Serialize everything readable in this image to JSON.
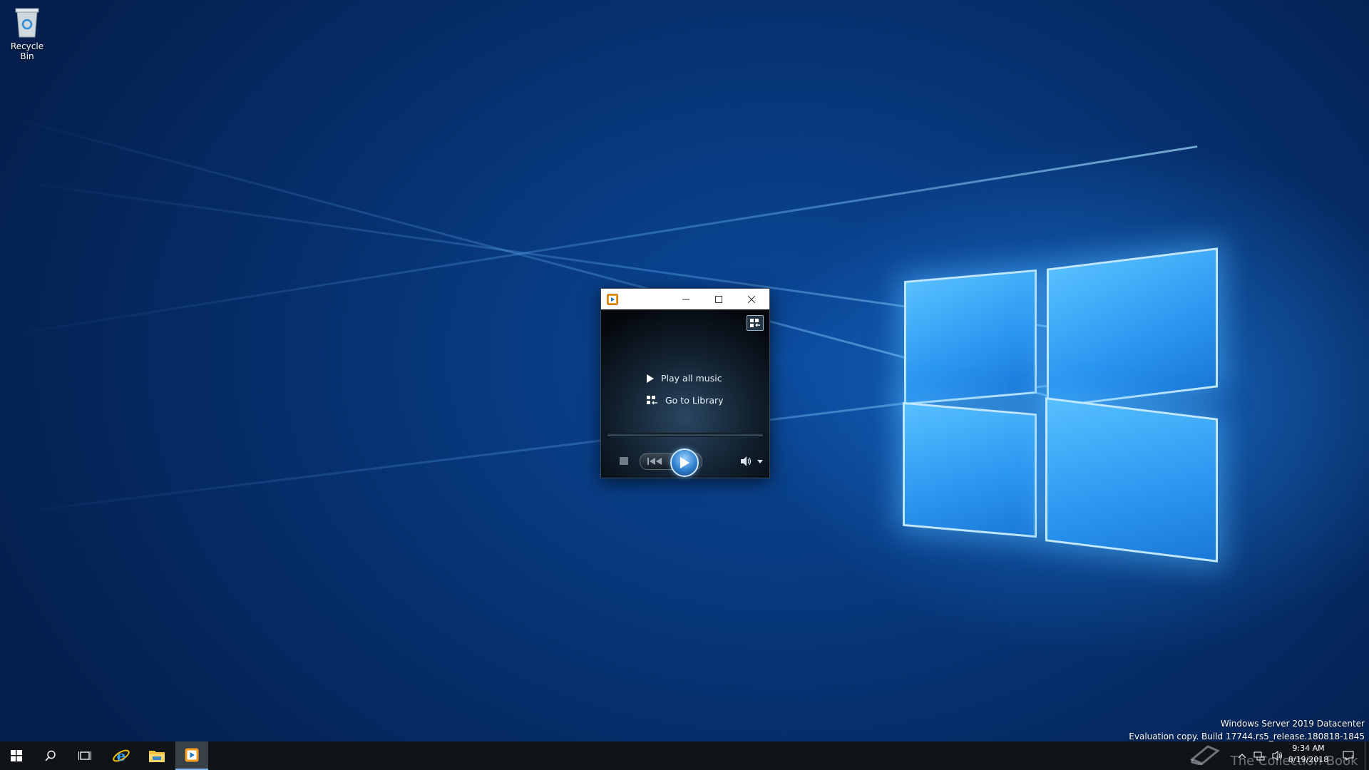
{
  "desktop": {
    "icons": [
      {
        "label": "Recycle Bin",
        "icon": "recycle-bin-icon"
      }
    ]
  },
  "wmp_window": {
    "title_icon": "media-player-icon",
    "buttons": {
      "minimize": "minimize-icon",
      "maximize": "maximize-icon",
      "close": "close-icon"
    },
    "switch_to_library_icon": "library-grid-icon",
    "menu": {
      "play_all": "Play all music",
      "go_to_library": "Go to Library"
    },
    "controls": [
      "stop-icon",
      "previous-icon",
      "play-icon",
      "next-icon",
      "volume-icon",
      "chevron-down-icon"
    ]
  },
  "watermark": {
    "line1": "Windows Server 2019 Datacenter",
    "line2": "Evaluation copy. Build 17744.rs5_release.180818-1845"
  },
  "taskbar": {
    "items": [
      "windows-start-icon",
      "search-icon",
      "task-view-icon",
      "internet-explorer-icon",
      "file-explorer-icon",
      "media-player-icon"
    ],
    "tray": {
      "time": "9:34 AM",
      "date": "8/19/2018",
      "icons": [
        "chevron-up-icon",
        "network-icon",
        "speaker-icon",
        "notifications-icon"
      ]
    },
    "overlay_text": "The Collection Book"
  },
  "colors": {
    "desktop_bg": "#06306e",
    "accent": "#2f7fd0",
    "taskbar": "#101418"
  }
}
